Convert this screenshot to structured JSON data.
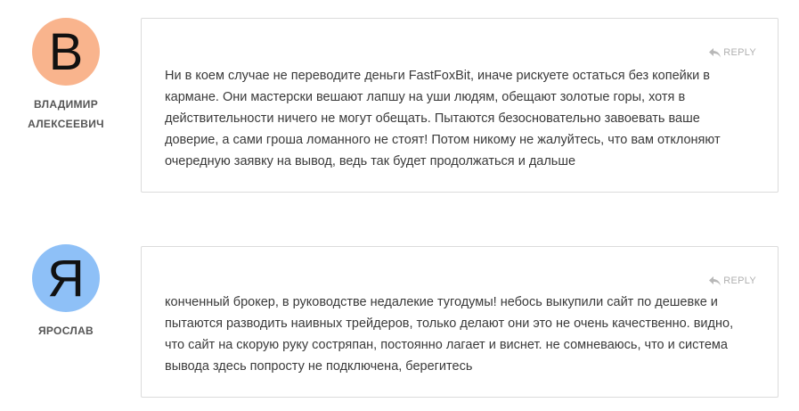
{
  "comments": [
    {
      "avatar_letter": "В",
      "avatar_color": "#f9b48d",
      "author": "ВЛАДИМИР АЛЕКСЕЕВИЧ",
      "reply_label": "REPLY",
      "text": "Ни в коем случае не переводите деньги FastFoxBit, иначе рискуете остаться без копейки в кармане. Они мастерски вешают лапшу на уши людям, обещают золотые горы, хотя в действительности ничего не могут обещать. Пытаются безосновательно завоевать ваше доверие, а сами гроша ломанного не стоят! Потом никому не жалуйтесь, что вам отклоняют очередную заявку на вывод, ведь так будет продолжаться и дальше"
    },
    {
      "avatar_letter": "Я",
      "avatar_color": "#8ec0f7",
      "author": "ЯРОСЛАВ",
      "reply_label": "REPLY",
      "text": "конченный брокер, в руководстве недалекие тугодумы! небось выкупили сайт по дешевке и пытаются разводить наивных трейдеров, только делают они это не очень качественно. видно, что сайт на скорую руку состряпан, постоянно лагает и виснет. не сомневаюсь, что и система вывода здесь попросту не подключена, берегитесь"
    }
  ],
  "icons": {
    "reply": "reply-arrow-icon"
  }
}
